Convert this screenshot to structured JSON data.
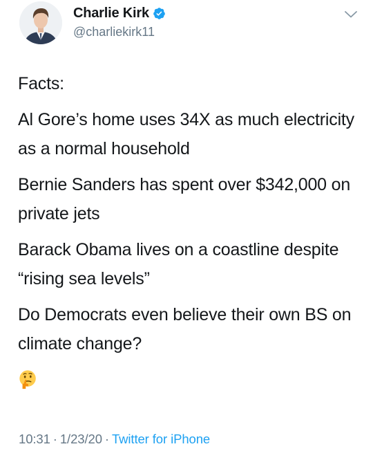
{
  "author": {
    "display_name": "Charlie Kirk",
    "handle": "@charliekirk11",
    "verified": true
  },
  "tweet": {
    "paragraphs": [
      "Facts:",
      "Al Gore’s home uses 34X as much electricity as a normal household",
      "Bernie Sanders has spent over $342,000 on private jets",
      "Barack Obama lives on a coastline despite “rising sea levels”",
      "Do Democrats even believe their own BS on climate change?"
    ],
    "emoji": "thinking-face"
  },
  "meta": {
    "time": "10:31",
    "separator": "·",
    "date": "1/23/20",
    "source": "Twitter for iPhone"
  },
  "colors": {
    "text": "#14171a",
    "secondary": "#657786",
    "link": "#1da1f2",
    "verified_badge": "#1da1f2"
  }
}
